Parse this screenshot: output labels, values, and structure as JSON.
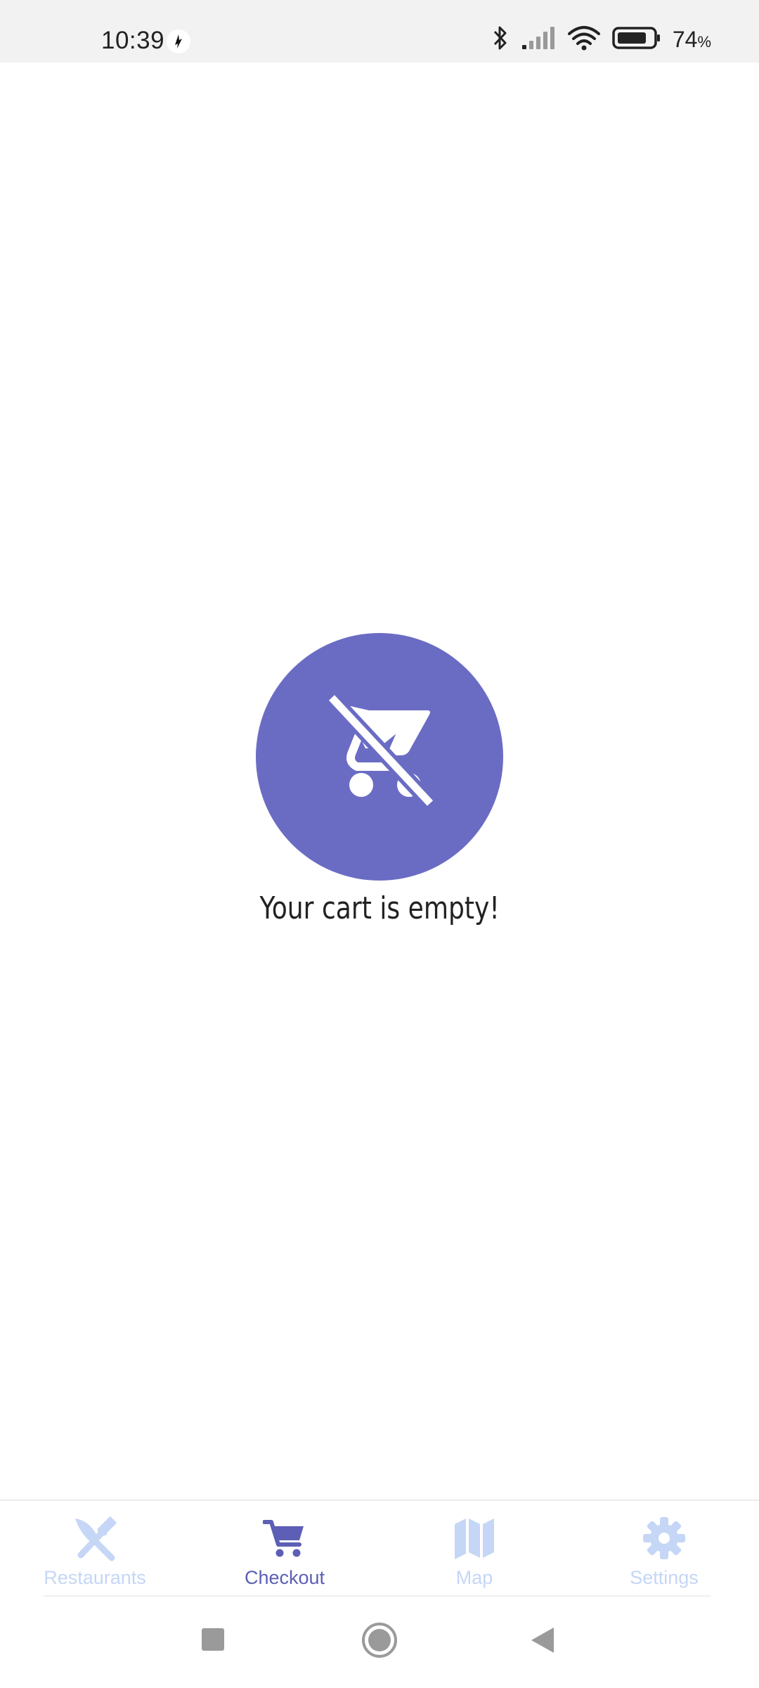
{
  "status_bar": {
    "time": "10:39",
    "battery_value": "74",
    "battery_unit": "%",
    "icons": [
      "app-notification-icon",
      "bluetooth-icon",
      "signal-icon",
      "wifi-icon",
      "battery-icon"
    ]
  },
  "empty_state": {
    "icon": "remove-shopping-cart-icon",
    "message": "Your cart is empty!",
    "circle_color": "#6a6cc4"
  },
  "bottom_nav": {
    "active_color": "#5c5fb5",
    "inactive_color": "#c5d6f6",
    "items": [
      {
        "label": "Restaurants",
        "icon": "restaurant-icon",
        "active": false
      },
      {
        "label": "Checkout",
        "icon": "shopping-cart-icon",
        "active": true
      },
      {
        "label": "Map",
        "icon": "map-icon",
        "active": false
      },
      {
        "label": "Settings",
        "icon": "settings-icon",
        "active": false
      }
    ]
  },
  "system_nav": {
    "buttons": [
      "recents-button",
      "home-button",
      "back-button"
    ]
  }
}
